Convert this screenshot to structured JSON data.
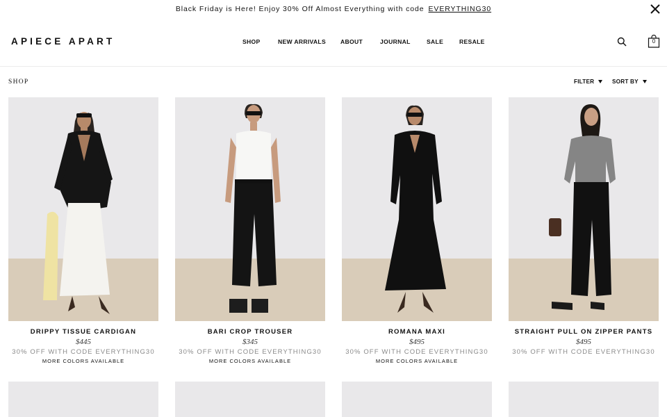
{
  "promo": {
    "text": "Black Friday is Here! Enjoy 30% Off Almost Everything with code",
    "code": "EVERYTHING30"
  },
  "header": {
    "logo": "APIECE APART",
    "nav": [
      "SHOP",
      "NEW ARRIVALS",
      "ABOUT",
      "JOURNAL",
      "SALE",
      "RESALE"
    ],
    "bag_count": "0"
  },
  "toolbar": {
    "breadcrumb": "SHOP",
    "filter": "FILTER",
    "sort": "SORT BY"
  },
  "products": [
    {
      "name": "DRIPPY TISSUE CARDIGAN",
      "price": "$445",
      "promo": "30% OFF WITH CODE EVERYTHING30",
      "colors": "MORE COLORS AVAILABLE"
    },
    {
      "name": "BARI CROP TROUSER",
      "price": "$345",
      "promo": "30% OFF WITH CODE EVERYTHING30",
      "colors": "MORE COLORS AVAILABLE"
    },
    {
      "name": "ROMANA MAXI",
      "price": "$495",
      "promo": "30% OFF WITH CODE EVERYTHING30",
      "colors": "MORE COLORS AVAILABLE"
    },
    {
      "name": "STRAIGHT PULL ON ZIPPER PANTS",
      "price": "$495",
      "promo": "30% OFF WITH CODE EVERYTHING30",
      "colors": ""
    }
  ],
  "icons": {
    "close": "close-icon",
    "search": "search-icon",
    "bag": "shopping-bag-icon",
    "caret": "caret-down-icon"
  },
  "colors": {
    "text": "#111111",
    "muted": "#8a8a8a",
    "wall": "#e9e8ea",
    "floor": "#d9ccb9"
  }
}
